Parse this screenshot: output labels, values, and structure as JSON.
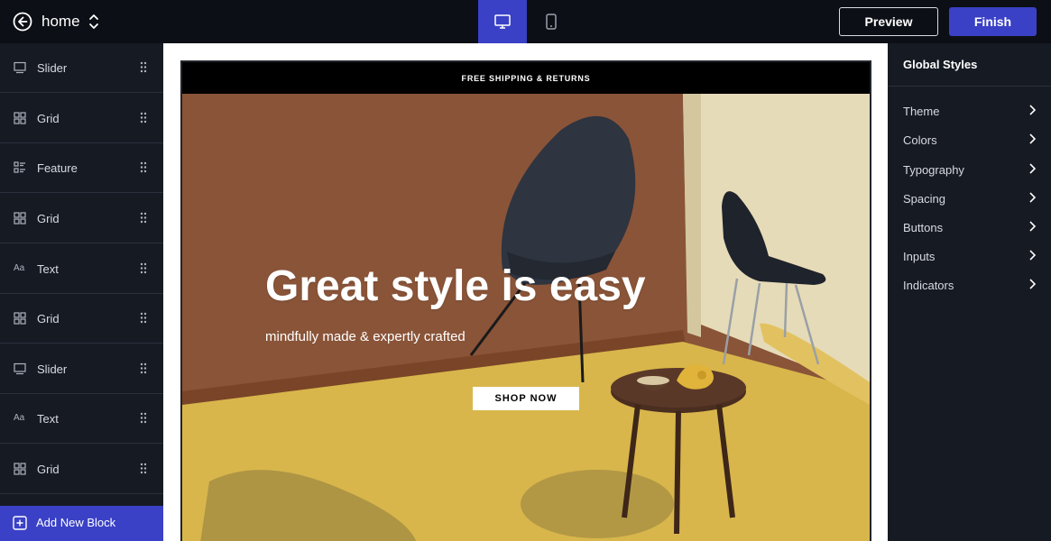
{
  "topbar": {
    "page_name": "home",
    "preview_label": "Preview",
    "finish_label": "Finish"
  },
  "sidebar": {
    "blocks": [
      {
        "label": "Slider",
        "icon": "slider-icon"
      },
      {
        "label": "Grid",
        "icon": "grid-icon"
      },
      {
        "label": "Feature",
        "icon": "feature-icon"
      },
      {
        "label": "Grid",
        "icon": "grid-icon"
      },
      {
        "label": "Text",
        "icon": "text-icon"
      },
      {
        "label": "Grid",
        "icon": "grid-icon"
      },
      {
        "label": "Slider",
        "icon": "slider-icon"
      },
      {
        "label": "Text",
        "icon": "text-icon"
      },
      {
        "label": "Grid",
        "icon": "grid-icon"
      }
    ],
    "add_block_label": "Add New Block",
    "text_icon_glyph": "Aa"
  },
  "canvas": {
    "announcement": "FREE SHIPPING & RETURNS",
    "hero_title": "Great style is easy",
    "hero_subtitle": "mindfully made & expertly crafted",
    "cta_label": "SHOP NOW"
  },
  "global_styles": {
    "title": "Global Styles",
    "items": [
      "Theme",
      "Colors",
      "Typography",
      "Spacing",
      "Buttons",
      "Inputs",
      "Indicators"
    ]
  },
  "colors": {
    "accent": "#3a41c6",
    "topbar_bg": "#0c0f15",
    "panel_bg": "#161a23"
  }
}
